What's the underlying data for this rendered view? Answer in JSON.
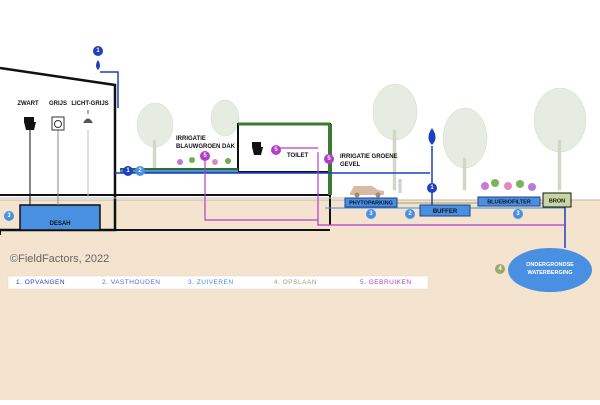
{
  "labels": {
    "zwart": "ZWART",
    "grijs": "GRIJS",
    "licht_grijs": "LICHT-GRIJS",
    "desah": "DESAH",
    "irrigatie_dak_1": "IRRIGATIE",
    "irrigatie_dak_2": "BLAUWGROEN DAK",
    "toilet": "TOILET",
    "irrigatie_gevel_1": "IRRIGATIE GROENE",
    "irrigatie_gevel_2": "GEVEL",
    "phytoparking": "PHYTOPARKING",
    "buffer": "BUFFER",
    "bluebiofilter": "BLUEBIOFILTER",
    "bron": "BRON",
    "waterberging_1": "ONDERGRONDSE",
    "waterberging_2": "WATERBERGING",
    "copyright": "©FieldFactors, 2022"
  },
  "badges": {
    "b1": "1",
    "b2": "2",
    "b3": "3",
    "b4": "4",
    "b5": "5"
  },
  "legend": [
    {
      "label": "1.  OPVANGEN",
      "color": "#1f3fbf"
    },
    {
      "label": "2.  VASTHOUDEN",
      "color": "#4a6fe0"
    },
    {
      "label": "3.  ZUIVEREN",
      "color": "#3a8fd8"
    },
    {
      "label": "4.  OPSLAAN",
      "color": "#9aa86a"
    },
    {
      "label": "5.  GEBRUIKEN",
      "color": "#b23fc8"
    }
  ],
  "colors": {
    "ground": "#f3e3cf",
    "store_blue": "#4a90e2",
    "dark_blue": "#1f3fbf",
    "purple": "#b23fc8",
    "green_roof": "#3c7a32",
    "bron": "#c9d6a3",
    "badge_blue": "#1f3fbf",
    "badge_mid": "#4a90e2",
    "badge_olive": "#9aa86a"
  }
}
